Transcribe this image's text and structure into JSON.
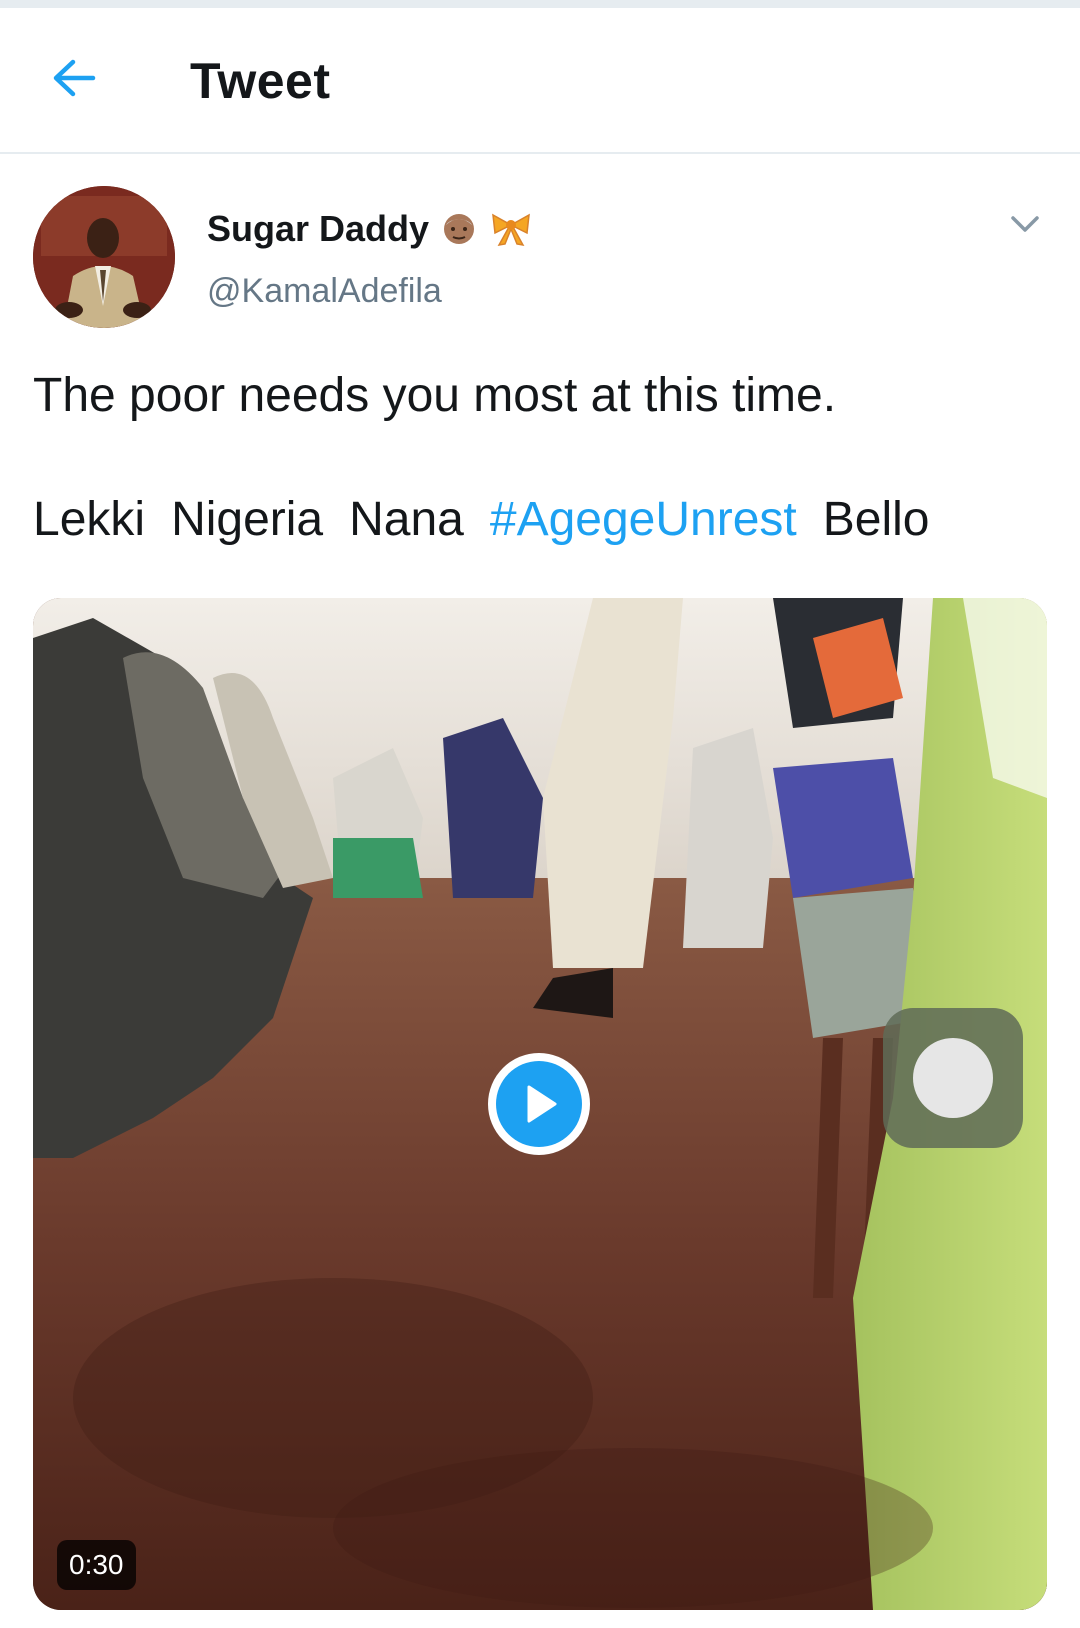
{
  "header": {
    "title": "Tweet",
    "back_icon": "back-arrow-icon"
  },
  "tweet": {
    "author": {
      "name": "Sugar Daddy",
      "handle": "@KamalAdefila",
      "emojis": [
        "old-man-emoji",
        "ribbon-emoji"
      ]
    },
    "text_line1": "The poor needs you most at this time.",
    "text_line2": {
      "word1": "Lekki",
      "word2": "Nigeria",
      "word3": "Nana",
      "hashtag": "#AgegeUnrest",
      "word4": "Bello"
    },
    "media": {
      "type": "video",
      "duration": "0:30"
    }
  },
  "colors": {
    "accent": "#1da1f2",
    "text": "#14171a",
    "secondary": "#657786",
    "divider": "#e6ecf0"
  }
}
